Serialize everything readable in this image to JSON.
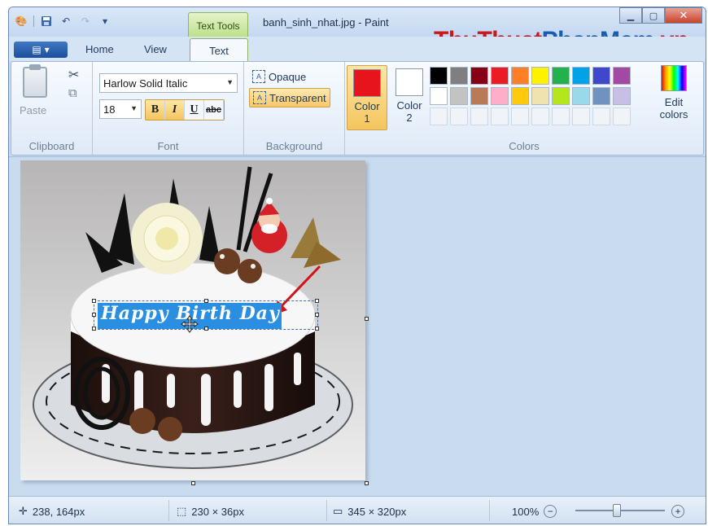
{
  "titlebar": {
    "context_tab": "Text Tools",
    "title": "banh_sinh_nhat.jpg - Paint",
    "watermark_part1": "ThuThuat",
    "watermark_part2": "PhanMem",
    "watermark_part3": ".vn"
  },
  "tabs": {
    "home": "Home",
    "view": "View",
    "text": "Text"
  },
  "clipboard": {
    "paste": "Paste",
    "label": "Clipboard"
  },
  "font": {
    "family": "Harlow Solid Italic",
    "size": "18",
    "label": "Font",
    "bold": "B",
    "italic": "I",
    "underline": "U",
    "strike": "abc"
  },
  "background": {
    "opaque": "Opaque",
    "transparent": "Transparent",
    "label": "Background"
  },
  "colors": {
    "color1_label": "Color",
    "color1_num": "1",
    "color2_label": "Color",
    "color2_num": "2",
    "color1": "#e8141c",
    "color2": "#ffffff",
    "edit_label_1": "Edit",
    "edit_label_2": "colors",
    "label": "Colors",
    "palette": [
      "#000000",
      "#7f7f7f",
      "#880015",
      "#ed1c24",
      "#ff7f27",
      "#fff200",
      "#22b14c",
      "#00a2e8",
      "#3f48cc",
      "#a349a4",
      "#ffffff",
      "#c3c3c3",
      "#b97a57",
      "#ffaec9",
      "#ffc90e",
      "#efe4b0",
      "#b5e61d",
      "#99d9ea",
      "#7092be",
      "#c8bfe7"
    ]
  },
  "canvas": {
    "text": "Happy Birth Day"
  },
  "status": {
    "cursor": "238, 164px",
    "selection": "230 × 36px",
    "image_size": "345 × 320px",
    "zoom": "100%"
  }
}
